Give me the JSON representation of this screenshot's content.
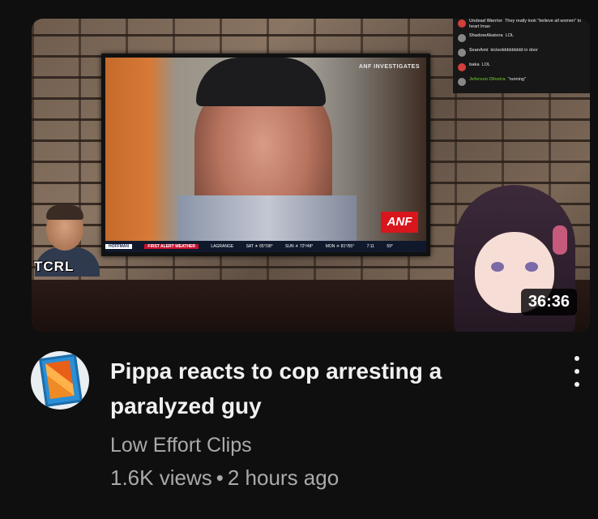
{
  "video": {
    "title": "Pippa reacts to cop arresting a paralyzed guy",
    "duration": "36:36",
    "channel": "Low Effort Clips",
    "views": "1.6K views",
    "separator": "•",
    "age": "2 hours ago"
  },
  "thumbnail": {
    "overlay_logo": "TCRL",
    "tv_header": "ANF INVESTIGATES",
    "tv_badge": "ANF",
    "ticker": [
      "HOFFMAN",
      "FIRST ALERT WEATHER",
      "LAGRANGE",
      "SAT ☀ 65°/38°",
      "SUN ☀ 72°/48°",
      "MON ☀ 81°/55°",
      "7:11",
      "59°"
    ],
    "chat": [
      {
        "user": "Undead Warrior",
        "text": "They really took \"believe all women\" to heart lmao",
        "avatar": "red"
      },
      {
        "user": "ShadowAkatora",
        "text": "LOL",
        "avatar": "gray"
      },
      {
        "user": "SeanAmi",
        "text": "kickeddddddddd in door",
        "avatar": "gray"
      },
      {
        "user": "baka",
        "text": "LOL",
        "avatar": "red"
      },
      {
        "user": "Jeferson Oliveira",
        "text": "\"running\"",
        "avatar": "gray"
      }
    ]
  },
  "icons": {
    "more": "more-vert-icon",
    "channel_avatar": "film-strip-icon"
  },
  "colors": {
    "background": "#0f0f0f",
    "primary_text": "#f1f1f1",
    "secondary_text": "#aaaaaa",
    "duration_bg": "#000000cc"
  }
}
